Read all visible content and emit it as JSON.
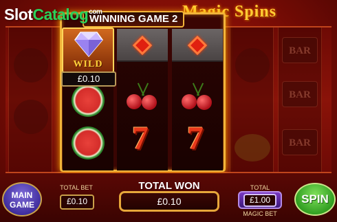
{
  "watermark": {
    "part1": "Slot",
    "part2": "Catalog",
    "part3": "com"
  },
  "title": "Magic Spins",
  "feature": {
    "banner": "WINNING GAME 2",
    "wild_label": "WILD",
    "line_win": "£0.10"
  },
  "bottom_bar": {
    "main_game_line1": "MAIN",
    "main_game_line2": "GAME",
    "total_bet_label": "TOTAL BET",
    "total_bet_value": "£0.10",
    "total_won_label": "TOTAL WON",
    "total_won_value": "£0.10",
    "magic_bet_label_top": "TOTAL",
    "magic_bet_value": "£1.00",
    "magic_bet_label_bottom": "MAGIC BET",
    "spin_label": "SPIN"
  },
  "background_reels": {
    "bar_label": "BAR"
  },
  "colors": {
    "accent_gold": "#f2b43a",
    "spin_green": "#2c9a1e",
    "main_purple": "#3c2a9a"
  }
}
